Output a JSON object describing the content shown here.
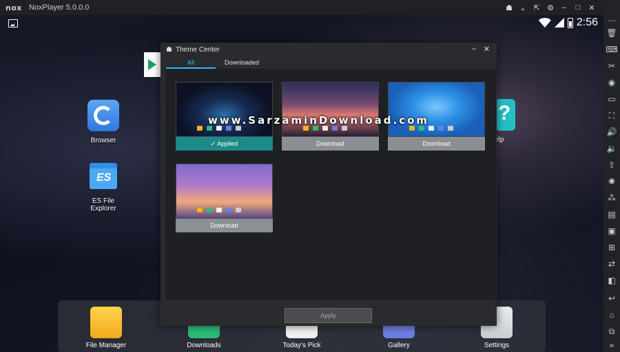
{
  "titlebar": {
    "logo": "nox",
    "title": "NoxPlayer 5.0.0.0"
  },
  "statusbar": {
    "time": "2:56"
  },
  "desktop": {
    "apps": [
      {
        "label": "Browser"
      },
      {
        "label": "ES File Explorer"
      }
    ],
    "help_label": "elp"
  },
  "dock": {
    "apps": [
      {
        "label": "File Manager"
      },
      {
        "label": "Downloads"
      },
      {
        "label": "Today's Pick"
      },
      {
        "label": "Gallery"
      },
      {
        "label": "Settings"
      }
    ]
  },
  "theme_center": {
    "title": "Theme Center",
    "tabs": [
      {
        "label": "All",
        "active": true
      },
      {
        "label": "Downloaded",
        "active": false
      }
    ],
    "themes": [
      {
        "status": "Applied",
        "applied": true
      },
      {
        "status": "Download",
        "applied": false
      },
      {
        "status": "Download",
        "applied": false
      },
      {
        "status": "Download",
        "applied": false
      }
    ],
    "apply_label": "Apply"
  },
  "watermark": "www.SarzaminDownload.com",
  "colors": {
    "accent": "#38b7ff",
    "applied_bar": "#1d8a8a"
  }
}
